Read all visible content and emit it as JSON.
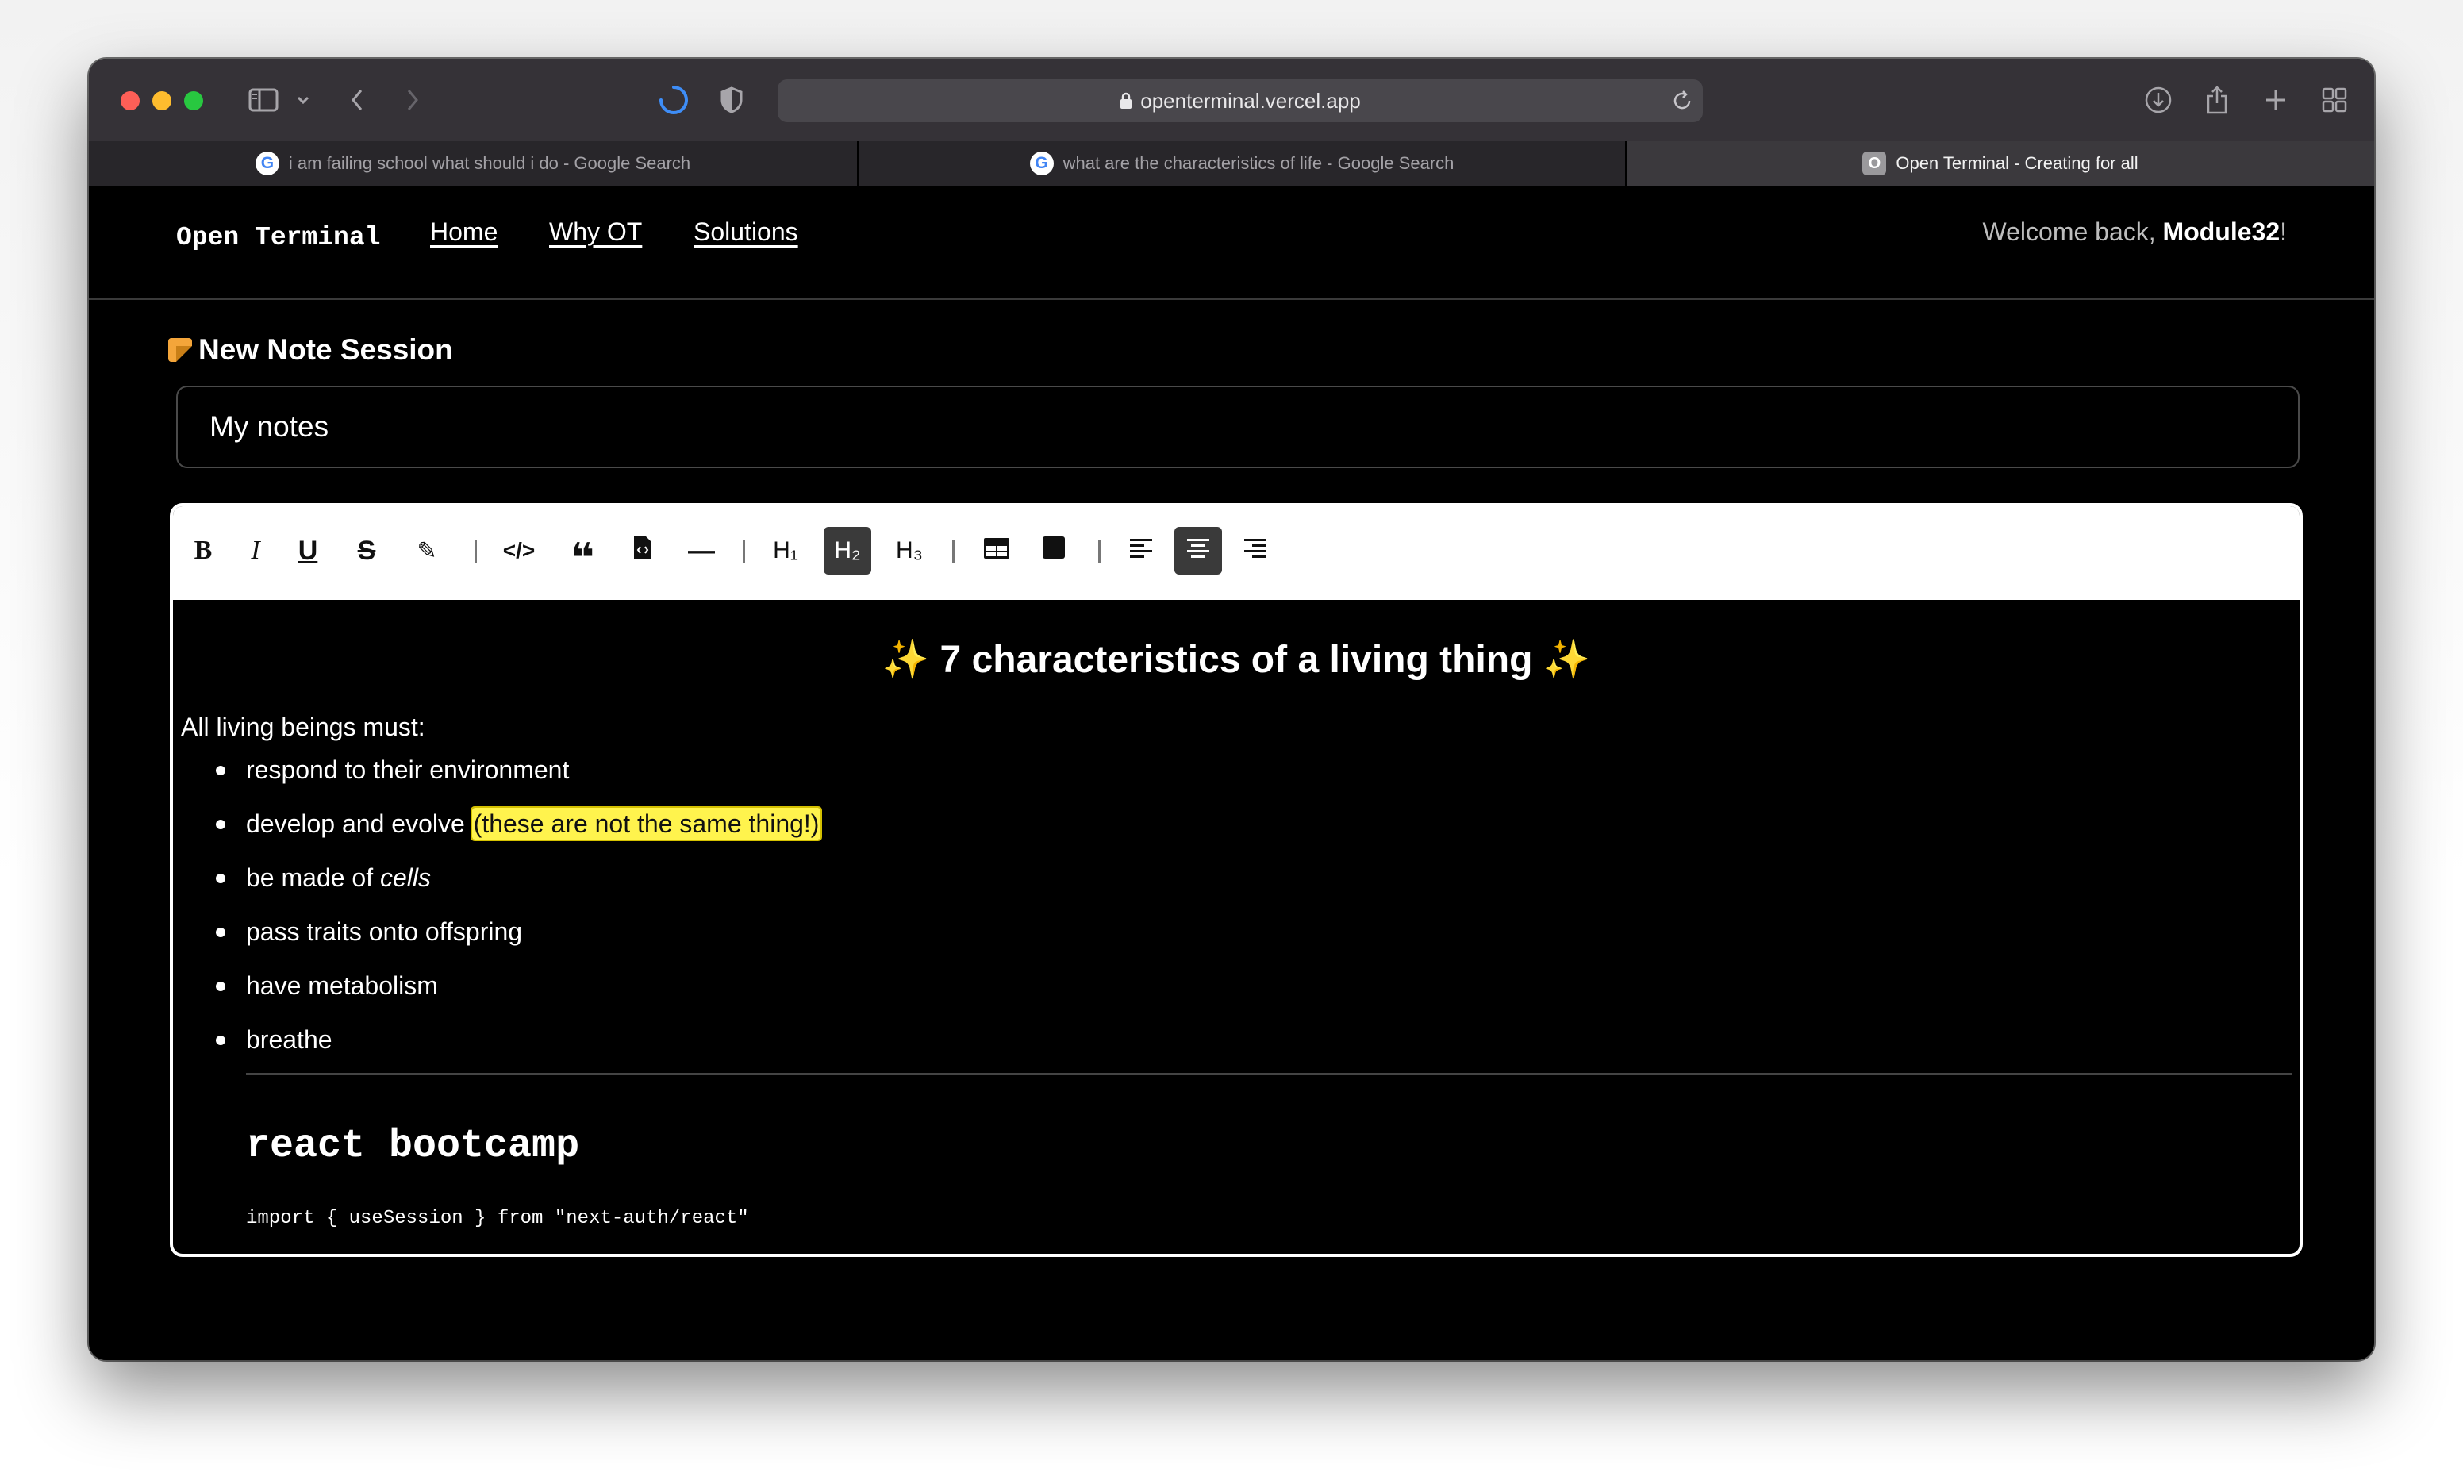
{
  "browser": {
    "url": "openterminal.vercel.app",
    "tabs": [
      {
        "title": "i am failing school what should i do - Google Search",
        "favicon": "G",
        "active": false
      },
      {
        "title": "what are the characteristics of life - Google Search",
        "favicon": "G",
        "active": false
      },
      {
        "title": "Open Terminal - Creating for all",
        "favicon": "O",
        "active": true
      }
    ]
  },
  "nav": {
    "logo": "Open Terminal",
    "links": [
      "Home",
      "Why OT",
      "Solutions"
    ],
    "welcome_prefix": "Welcome back, ",
    "username": "Module32",
    "welcome_suffix": "!"
  },
  "session": {
    "title": "New Note Session",
    "title_icon": "memo-icon",
    "note_title_value": "My notes"
  },
  "editor_toolbar": {
    "buttons": [
      {
        "name": "bold",
        "label": "B"
      },
      {
        "name": "italic",
        "label": "I"
      },
      {
        "name": "underline",
        "label": "U"
      },
      {
        "name": "strikethrough",
        "label": "S"
      },
      {
        "name": "highlight",
        "label": "✎"
      },
      {
        "name": "code",
        "label": "</>"
      },
      {
        "name": "blockquote",
        "label": "❝"
      },
      {
        "name": "code-block",
        "label": ""
      },
      {
        "name": "horizontal-rule",
        "label": "—"
      },
      {
        "name": "heading-1",
        "label": "H₁"
      },
      {
        "name": "heading-2",
        "label": "H₂",
        "active": true
      },
      {
        "name": "heading-3",
        "label": "H₃"
      },
      {
        "name": "table",
        "label": ""
      },
      {
        "name": "block",
        "label": ""
      },
      {
        "name": "align-left",
        "label": ""
      },
      {
        "name": "align-center",
        "label": "",
        "active": true
      },
      {
        "name": "align-right",
        "label": ""
      }
    ]
  },
  "content": {
    "heading": "✨ 7 characteristics of a living thing ✨",
    "heading_spark": "✨",
    "heading_text": " 7 characteristics of a living thing ",
    "intro": "All living beings must:",
    "bullets": [
      {
        "text": "respond to their environment"
      },
      {
        "text": "develop and evolve ",
        "highlight": "(these are not the same thing!)"
      },
      {
        "text": "be made of ",
        "italic": "cells"
      },
      {
        "text": "pass traits onto offspring"
      },
      {
        "text": "have metabolism"
      },
      {
        "text": "breathe"
      }
    ],
    "code_heading": "react bootcamp",
    "code_line": "import { useSession } from \"next-auth/react\""
  },
  "colors": {
    "highlight": "#fff34d",
    "brand_note_icon": "#f4a53a",
    "page_bg": "#000000"
  }
}
